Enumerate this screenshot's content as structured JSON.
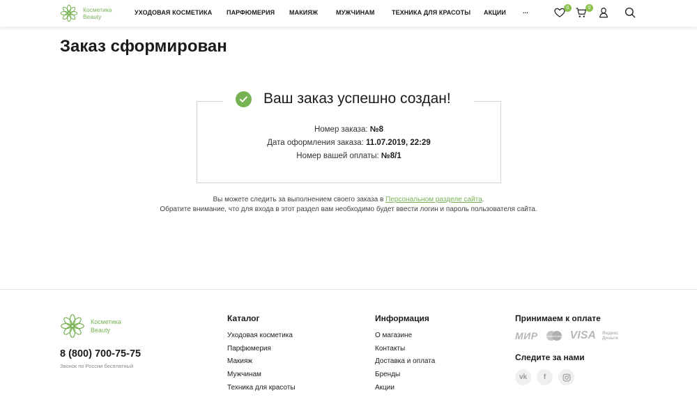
{
  "brand": {
    "line1": "Косметика",
    "line2": "Beauty",
    "color": "#77b255"
  },
  "nav": {
    "items": [
      "УХОДОВАЯ КОСМЕТИКА",
      "ПАРФЮМЕРИЯ",
      "МАКИЯЖ",
      "МУЖЧИНАМ",
      "ТЕХНИКА ДЛЯ КРАСОТЫ",
      "АКЦИИ",
      "..."
    ]
  },
  "header_icons": {
    "favorites_icon": "heart-icon",
    "favorites_count": "0",
    "cart_icon": "cart-icon",
    "cart_count": "0",
    "account_icon": "user-icon",
    "search_icon": "search-icon"
  },
  "page": {
    "title": "Заказ сформирован"
  },
  "order": {
    "success_title": "Ваш заказ успешно создан!",
    "number_label": "Номер заказа:",
    "number_value": "№8",
    "date_label": "Дата оформления заказа:",
    "date_value": "11.07.2019, 22:29",
    "payment_label": "Номер вашей оплаты:",
    "payment_value": "№8/1"
  },
  "note": {
    "line1_prefix": "Вы можете следить за выполнением своего заказа в ",
    "line1_link": "Персональном разделе сайта",
    "line1_suffix": ".",
    "line2": "Обратите внимание, что для входа в этот раздел вам необходимо будет ввести логин и пароль пользователя сайта."
  },
  "footer": {
    "phone": "8 (800) 700-75-75",
    "phone_note": "Звонок по России бесплатный",
    "catalog": {
      "title": "Каталог",
      "items": [
        "Уходовая косметика",
        "Парфюмерия",
        "Макияж",
        "Мужчинам",
        "Техника для красоты"
      ]
    },
    "info": {
      "title": "Информация",
      "items": [
        "О магазине",
        "Контакты",
        "Доставка и оплата",
        "Бренды",
        "Акции"
      ]
    },
    "payment": {
      "title": "Принимаем к оплате",
      "mir": "МИР",
      "mastercard": "MasterCard",
      "visa": "VISA",
      "yandex_line1": "Яндекс",
      "yandex_line2": "Деньги"
    },
    "follow": {
      "title": "Следите за нами",
      "vk": "vk",
      "fb": "f"
    }
  }
}
